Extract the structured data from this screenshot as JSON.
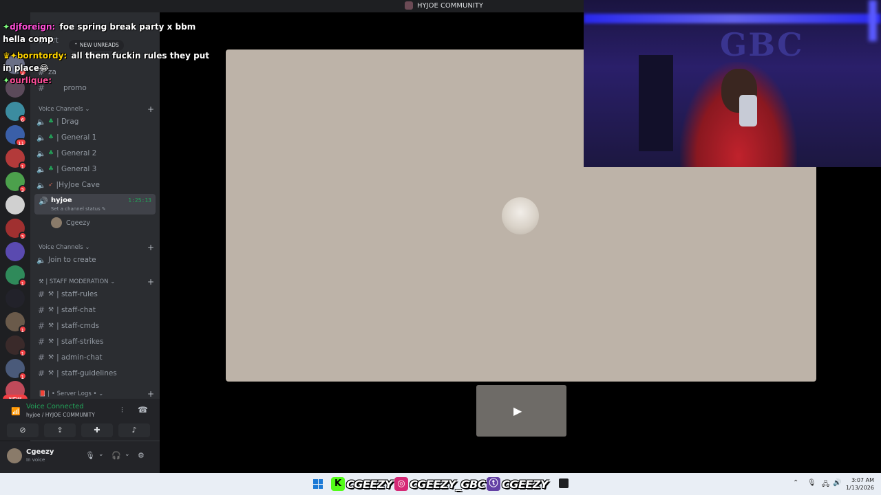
{
  "window": {
    "title": "HYJOE COMMUNITY"
  },
  "sidebar": {
    "server_name": "HYJOE COMMUNITY",
    "new_unreads": "NEW UNREADS",
    "top_channels": [
      {
        "label": "art"
      },
      {
        "label": "za"
      },
      {
        "label": "promo"
      }
    ],
    "voice_category_1": "Voice Channels",
    "voice_channels": [
      {
        "label": "| Drag"
      },
      {
        "label": "| General 1"
      },
      {
        "label": "| General 2"
      },
      {
        "label": "| General 3"
      },
      {
        "label": "|HyJoe Cave"
      }
    ],
    "active_channel": {
      "name": "hyjoe",
      "timer": "1:25:13",
      "status": "Set a channel status"
    },
    "voice_user": "Cgeezy",
    "voice_category_2": "Voice Channels",
    "join_to_create": "Join to create",
    "staff_category": "| STAFF MODERATION",
    "staff_channels": [
      {
        "label": "| staff-rules"
      },
      {
        "label": "| staff-chat"
      },
      {
        "label": "| staff-cmds"
      },
      {
        "label": "| staff-strikes"
      },
      {
        "label": "| admin-chat"
      },
      {
        "label": "| staff-guidelines"
      }
    ],
    "server_logs_category": "| • Server Logs •"
  },
  "rail": {
    "badges": [
      "3",
      "6",
      "11",
      "1",
      "3",
      "3",
      "1",
      "1",
      "1",
      "1",
      "1"
    ],
    "new_label": "NEW"
  },
  "voice_panel": {
    "status": "Voice Connected",
    "location": "hyjoe / HYJOE COMMUNITY"
  },
  "user_panel": {
    "username": "Cgeezy",
    "status": "In voice"
  },
  "chat": [
    {
      "user": "djforeign:",
      "text": "foe spring break party x bbm hella comp",
      "color": "#ff4fd8"
    },
    {
      "user": "borntordy:",
      "text": "all them fuckin rules they put in place😂",
      "color": "#ffd400"
    },
    {
      "user": "ourlique:",
      "text": "",
      "color": "#ff4f9a"
    }
  ],
  "webcam": {
    "sign": "GBC"
  },
  "taskbar": {
    "kick_handle": "CGEEZY",
    "instagram_handle": "CGEEZY_GBC",
    "twitch_handle": "CGEEZY",
    "time": "3:07 AM",
    "date": "1/13/2026"
  },
  "colors": {
    "accent_green": "#23a55a",
    "badge_red": "#f23f43",
    "tile_bg": "#bdb3a8"
  }
}
